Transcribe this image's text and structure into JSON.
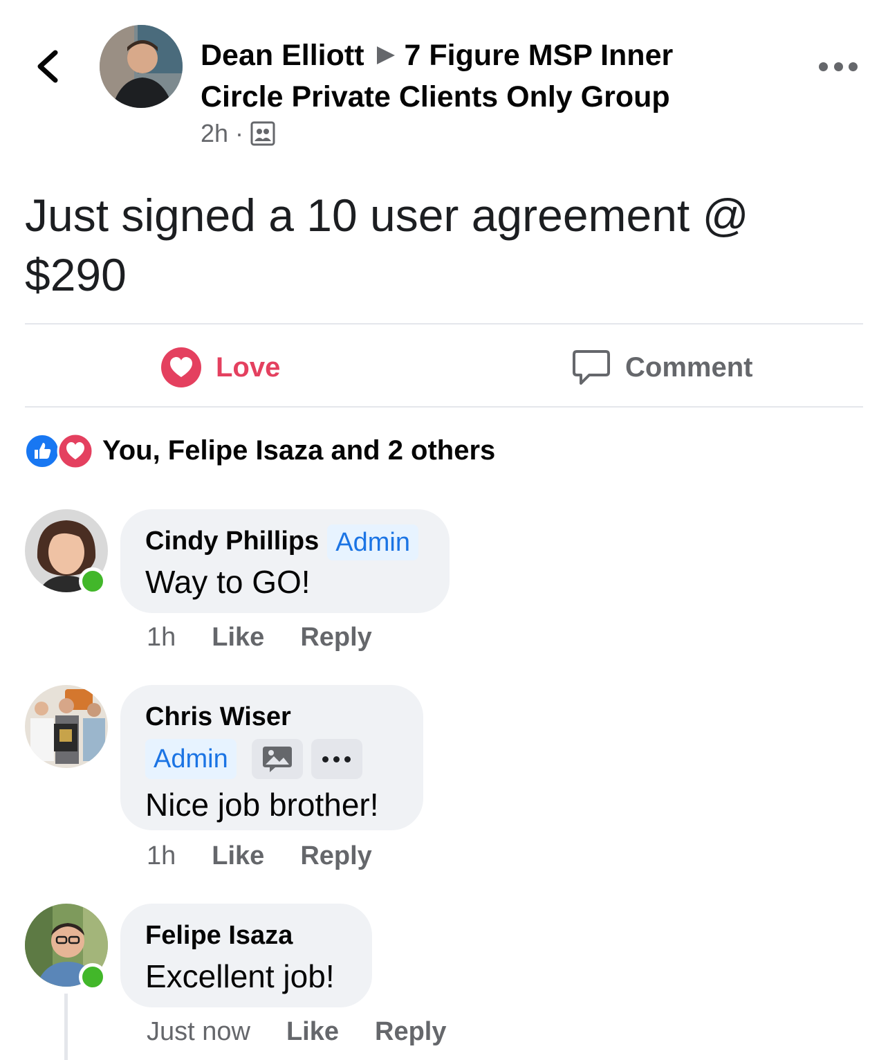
{
  "post": {
    "author": "Dean Elliott",
    "group_line1": "7 Figure MSP Inner",
    "group_line2": "Circle Private Clients Only Group",
    "time": "2h",
    "separator": "·",
    "audience_icon": "group-audience-icon",
    "text": "Just signed a 10 user agreement @ $290"
  },
  "actions": {
    "love_label": "Love",
    "comment_label": "Comment"
  },
  "reactions": {
    "summary": "You, Felipe Isaza and 2 others",
    "icons": [
      "like-icon",
      "love-icon"
    ]
  },
  "comments": [
    {
      "name": "Cindy Phillips",
      "badge": "Admin",
      "text": "Way to GO!",
      "time": "1h",
      "like_label": "Like",
      "reply_label": "Reply",
      "online": true
    },
    {
      "name": "Chris Wiser",
      "badge": "Admin",
      "text": "Nice job brother!",
      "time": "1h",
      "like_label": "Like",
      "reply_label": "Reply",
      "online": false
    },
    {
      "name": "Felipe Isaza",
      "badge": "",
      "text": "Excellent job!",
      "time": "Just now",
      "like_label": "Like",
      "reply_label": "Reply",
      "online": true
    }
  ],
  "colors": {
    "love": "#e4405f",
    "like": "#1877f2",
    "admin_badge_bg": "#e7f3ff",
    "admin_badge_text": "#1b74e4",
    "online": "#42b72a",
    "secondary_text": "#65676b"
  }
}
